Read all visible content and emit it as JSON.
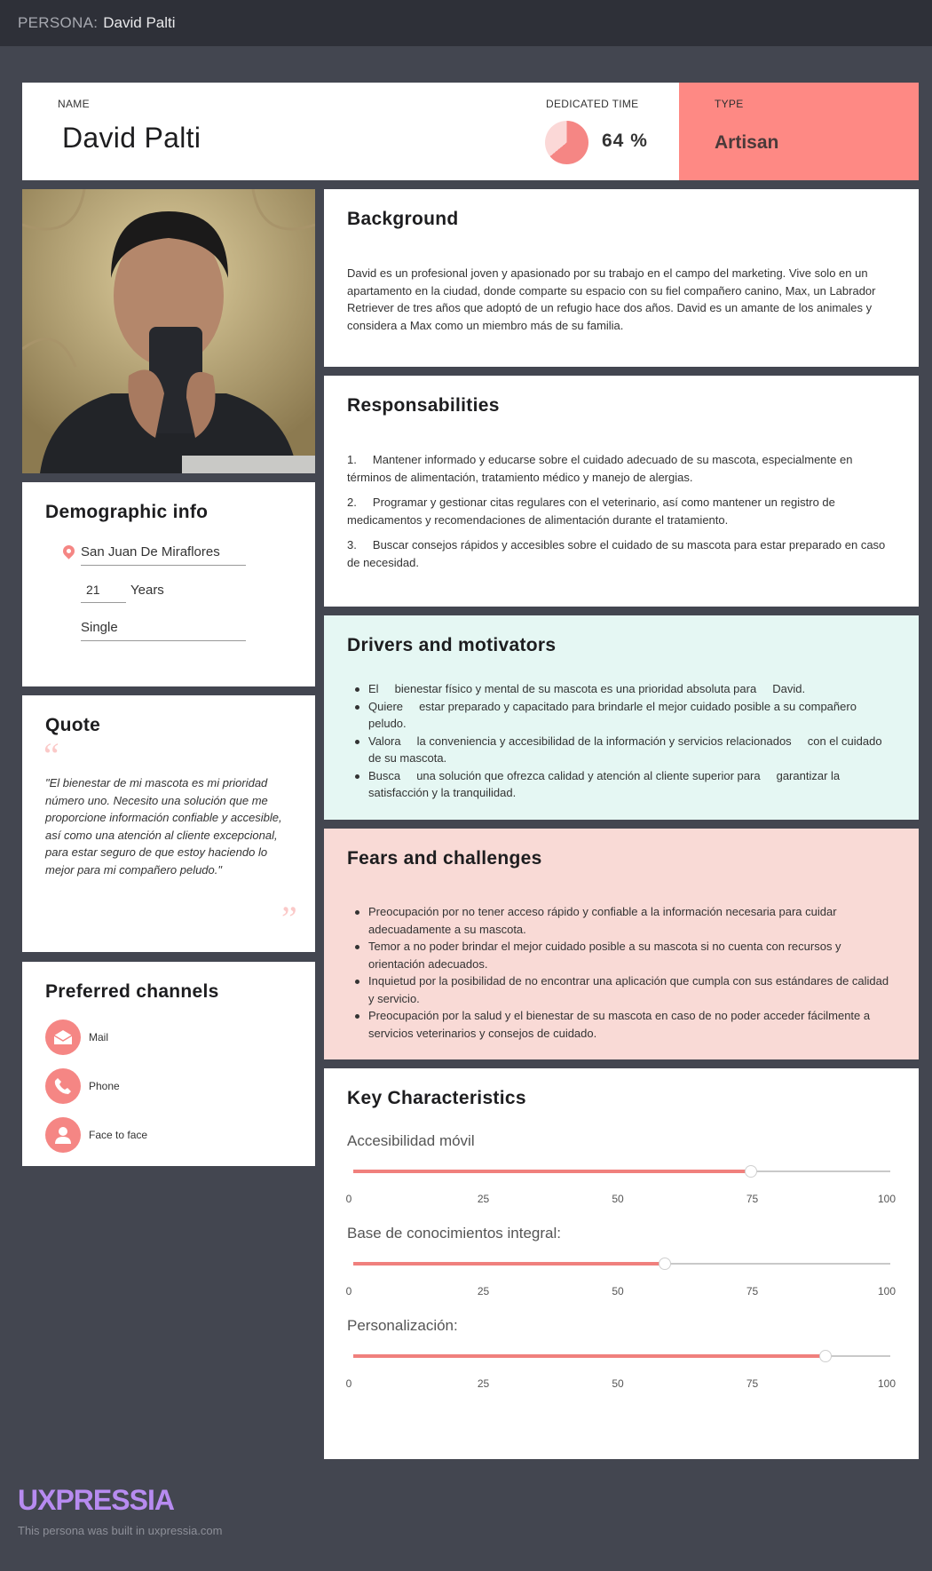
{
  "topbar": {
    "label": "PERSONA:",
    "name": "David Palti"
  },
  "header": {
    "name_label": "NAME",
    "name": "David Palti",
    "dedicated_time_label": "DEDICATED TIME",
    "dedicated_time_value": "64 %",
    "dedicated_time_fraction": 0.64,
    "type_label": "TYPE",
    "type_value": "Artisan"
  },
  "demographic": {
    "title": "Demographic info",
    "location": "San Juan De Miraflores",
    "age": "21",
    "age_unit": "Years",
    "status": "Single"
  },
  "quote": {
    "title": "Quote",
    "text": "\"El bienestar de mi mascota es mi prioridad número uno. Necesito una solución que me proporcione información confiable y accesible, así como una atención al cliente excepcional, para estar seguro de que estoy haciendo lo mejor para mi compañero peludo.\""
  },
  "channels": {
    "title": "Preferred channels",
    "items": [
      {
        "label": "Mail",
        "icon": "mail-icon"
      },
      {
        "label": "Phone",
        "icon": "phone-icon"
      },
      {
        "label": "Face to face",
        "icon": "person-icon"
      }
    ]
  },
  "background": {
    "title": "Background",
    "text": "David es un profesional joven y apasionado por su trabajo en el campo del marketing. Vive solo en un apartamento en la ciudad, donde comparte su espacio con su fiel compañero canino, Max, un Labrador Retriever de tres años que adoptó de un refugio hace dos años. David es un amante de los animales y considera a Max como un miembro más de su familia."
  },
  "responsabilities": {
    "title": "Responsabilities",
    "items": [
      "1.     Mantener informado y educarse sobre el cuidado adecuado de su mascota, especialmente en términos de alimentación, tratamiento médico y manejo de alergias.",
      "2.     Programar y gestionar citas regulares con el veterinario, así como mantener un registro de medicamentos y recomendaciones de alimentación durante el tratamiento.",
      "3.     Buscar consejos rápidos y accesibles sobre el cuidado de su mascota para estar preparado en caso de necesidad."
    ]
  },
  "drivers": {
    "title": "Drivers and motivators",
    "items": [
      "El     bienestar físico y mental de su mascota es una prioridad absoluta para     David.",
      "Quiere     estar preparado y capacitado para brindarle el mejor cuidado posible a su compañero peludo.",
      "Valora     la conveniencia y accesibilidad de la información y servicios relacionados     con el cuidado de su mascota.",
      "Busca     una solución que ofrezca calidad y atención al cliente superior para     garantizar la satisfacción y la tranquilidad."
    ]
  },
  "fears": {
    "title": "Fears and challenges",
    "items": [
      "Preocupación por no tener acceso rápido y confiable a la información necesaria para cuidar adecuadamente a su mascota.",
      "Temor a no poder brindar el mejor cuidado posible a su mascota si no cuenta con recursos y orientación adecuados.",
      "Inquietud por la posibilidad de no encontrar una aplicación que cumpla con sus estándares de calidad y servicio.",
      "Preocupación por la salud y el bienestar de su mascota en caso de no poder acceder fácilmente a servicios veterinarios y consejos de cuidado."
    ]
  },
  "key_characteristics": {
    "title": "Key Characteristics",
    "ticks": [
      "0",
      "25",
      "50",
      "75",
      "100"
    ],
    "sliders": [
      {
        "label": "Accesibilidad móvil",
        "value": 74
      },
      {
        "label": "Base de conocimientos integral:",
        "value": 58
      },
      {
        "label": "Personalización:",
        "value": 88
      }
    ]
  },
  "footer": {
    "logo": "UXPRESSIA",
    "note": "This persona was built in uxpressia.com"
  },
  "colors": {
    "accent": "#f58684",
    "type_bg": "#fe8984",
    "drivers_bg": "#e5f7f3",
    "fears_bg": "#f9dad6",
    "page_bg": "#434650"
  }
}
